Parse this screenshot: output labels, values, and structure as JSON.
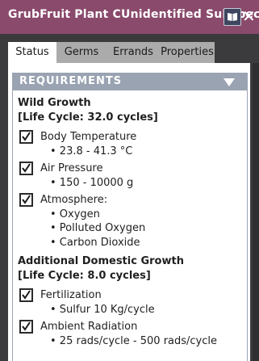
{
  "window": {
    "title": "GrubFruit Plant CUnidentified Subspec",
    "codex_button": "book-icon",
    "close_button": "✕"
  },
  "tabs": [
    {
      "label": "Status",
      "active": true
    },
    {
      "label": "Germs",
      "active": false
    },
    {
      "label": "Errands",
      "active": false
    },
    {
      "label": "Properties",
      "active": false
    }
  ],
  "requirements": {
    "header": "REQUIREMENTS",
    "wild": {
      "heading": "Wild Growth",
      "lifecycle": "[Life Cycle: 32.0 cycles]",
      "items": [
        {
          "label": "Body Temperature",
          "checked": true,
          "details": [
            "• 23.8 - 41.3 °C"
          ]
        },
        {
          "label": "Air Pressure",
          "checked": true,
          "details": [
            "• 150 - 10000 g"
          ]
        },
        {
          "label": "Atmosphere:",
          "checked": true,
          "details": [
            "• Oxygen",
            "• Polluted Oxygen",
            "• Carbon Dioxide"
          ]
        }
      ]
    },
    "domestic": {
      "heading": "Additional Domestic Growth",
      "lifecycle": "[Life Cycle: 8.0 cycles]",
      "items": [
        {
          "label": "Fertilization",
          "checked": true,
          "details": [
            "• Sulfur 10 Kg/cycle"
          ]
        },
        {
          "label": "Ambient Radiation",
          "checked": true,
          "details": [
            "• 25 rads/cycle - 500 rads/cycle"
          ]
        }
      ]
    }
  },
  "colors": {
    "titlebar": "#8a4a6c",
    "section_header": "#9aa3b2",
    "tab_active": "#ffffff",
    "tab_inactive": "#ababab"
  }
}
